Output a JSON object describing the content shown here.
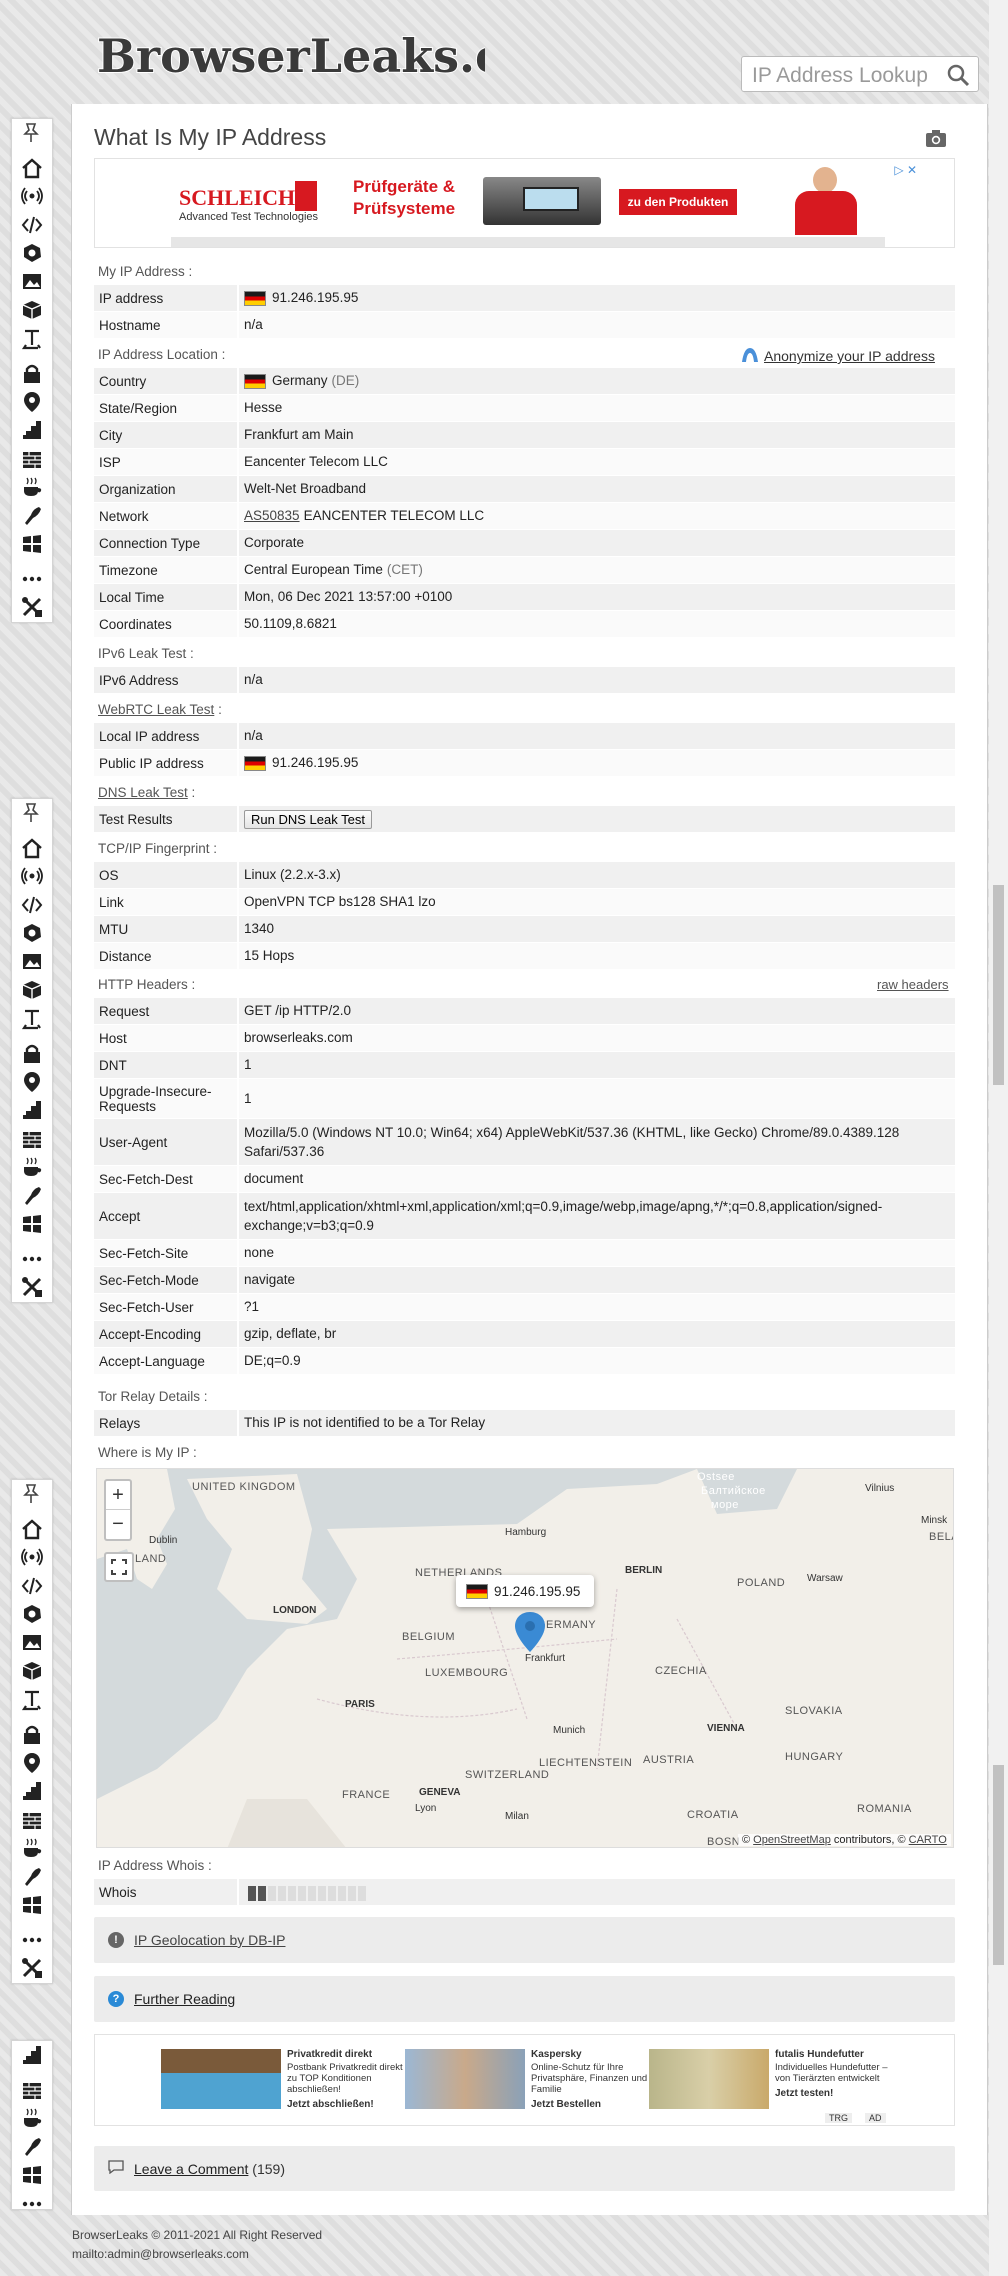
{
  "site": {
    "logo_text": "BrowserLeaks.com"
  },
  "search": {
    "placeholder": "IP Address Lookup"
  },
  "page_title": "What Is My IP Address",
  "ad_top": {
    "brand": "SCHLEICH",
    "tagline": "Advanced Test Technologies",
    "headline1": "Prüfgeräte &",
    "headline2": "Prüfsysteme",
    "cta": "zu den Produkten"
  },
  "sections": {
    "my_ip": "My IP Address :",
    "location": "IP Address Location :",
    "ipv6": "IPv6 Leak Test :",
    "webrtc": "WebRTC Leak Test",
    "dns": "DNS Leak Test",
    "tcpip": "TCP/IP Fingerprint :",
    "http": "HTTP Headers :",
    "tor": "Tor Relay Details :",
    "where": "Where is My IP :",
    "whois": "IP Address Whois :"
  },
  "anonymize_link": "Anonymize your IP address",
  "raw_headers_link": "raw headers",
  "my_ip": {
    "ip_label": "IP address",
    "ip_value": "91.246.195.95",
    "host_label": "Hostname",
    "host_value": "n/a"
  },
  "location": [
    {
      "k": "Country",
      "v": "Germany",
      "extra": "(DE)"
    },
    {
      "k": "State/Region",
      "v": "Hesse"
    },
    {
      "k": "City",
      "v": "Frankfurt am Main"
    },
    {
      "k": "ISP",
      "v": "Eancenter Telecom LLC"
    },
    {
      "k": "Organization",
      "v": "Welt-Net Broadband"
    },
    {
      "k": "Network",
      "link": "AS50835",
      "v": "EANCENTER TELECOM LLC"
    },
    {
      "k": "Connection Type",
      "v": "Corporate"
    },
    {
      "k": "Timezone",
      "v": "Central European Time",
      "extra": "(CET)"
    },
    {
      "k": "Local Time",
      "v": "Mon, 06 Dec 2021 13:57:00 +0100"
    },
    {
      "k": "Coordinates",
      "v": "50.1109,8.6821"
    }
  ],
  "ipv6": {
    "k": "IPv6 Address",
    "v": "n/a"
  },
  "webrtc": {
    "local_k": "Local IP address",
    "local_v": "n/a",
    "public_k": "Public IP address",
    "public_v": "91.246.195.95"
  },
  "dns": {
    "k": "Test Results",
    "button": "Run DNS Leak Test"
  },
  "tcpip": [
    {
      "k": "OS",
      "v": "Linux (2.2.x-3.x)"
    },
    {
      "k": "Link",
      "v": "OpenVPN TCP bs128 SHA1 lzo"
    },
    {
      "k": "MTU",
      "v": "1340"
    },
    {
      "k": "Distance",
      "v": "15 Hops"
    }
  ],
  "http": [
    {
      "k": "Request",
      "v": "GET /ip HTTP/2.0"
    },
    {
      "k": "Host",
      "v": "browserleaks.com"
    },
    {
      "k": "DNT",
      "v": "1"
    },
    {
      "k": "Upgrade-Insecure-Requests",
      "v": "1"
    },
    {
      "k": "User-Agent",
      "v": "Mozilla/5.0 (Windows NT 10.0; Win64; x64) AppleWebKit/537.36 (KHTML, like Gecko) Chrome/89.0.4389.128 Safari/537.36"
    },
    {
      "k": "Sec-Fetch-Dest",
      "v": "document"
    },
    {
      "k": "Accept",
      "v": "text/html,application/xhtml+xml,application/xml;q=0.9,image/webp,image/apng,*/*;q=0.8,application/signed-exchange;v=b3;q=0.9"
    },
    {
      "k": "Sec-Fetch-Site",
      "v": "none"
    },
    {
      "k": "Sec-Fetch-Mode",
      "v": "navigate"
    },
    {
      "k": "Sec-Fetch-User",
      "v": "?1"
    },
    {
      "k": "Accept-Encoding",
      "v": "gzip, deflate, br"
    },
    {
      "k": "Accept-Language",
      "v": "DE;q=0.9"
    }
  ],
  "tor": {
    "k": "Relays",
    "v": "This IP is not identified to be a Tor Relay"
  },
  "map": {
    "popup": "91.246.195.95",
    "zoom_in": "+",
    "zoom_out": "−",
    "attribution_prefix": "©",
    "osm": "OpenStreetMap",
    "contrib": "contributors, ©",
    "carto": "CARTO",
    "countries": [
      "UNITED KINGDOM",
      "NETHERLANDS",
      "BELGIUM",
      "LUXEMBOURG",
      "GERMANY",
      "POLAND",
      "CZECHIA",
      "SLOVAKIA",
      "FRANCE",
      "SWITZERLAND",
      "LIECHTENSTEIN",
      "AUSTRIA",
      "HUNGARY",
      "CROATIA",
      "ROMANIA",
      "BOSN",
      "BELA",
      "LAND"
    ],
    "cities": [
      "Dublin",
      "LONDON",
      "Hamburg",
      "BERLIN",
      "Warsaw",
      "PARIS",
      "Frankfurt",
      "Munich",
      "VIENNA",
      "GENEVA",
      "Lyon",
      "Milan",
      "Vilnius",
      "Minsk"
    ],
    "sea": [
      "Ostsee",
      "Балтийское",
      "море"
    ]
  },
  "whois": {
    "k": "Whois"
  },
  "geo_box": "IP Geolocation by DB-IP",
  "further_box": "Further Reading",
  "ad_bottom": [
    {
      "title": "Privatkredit direkt",
      "body": "Postbank Privatkredit direkt zu TOP Konditionen abschließen!",
      "cta": "Jetzt abschließen!"
    },
    {
      "title": "Kaspersky",
      "body": "Online-Schutz für Ihre Privatsphäre, Finanzen und Familie",
      "cta": "Jetzt Bestellen"
    },
    {
      "title": "futalis Hundefutter",
      "body": "Individuelles Hundefutter – von Tierärzten entwickelt",
      "cta": "Jetzt testen!"
    }
  ],
  "ad_tags": [
    "TRG",
    "AD"
  ],
  "comments": {
    "label": "Leave a Comment",
    "count": "(159)"
  },
  "footer": {
    "copy": "BrowserLeaks © 2011-2021 All Right Reserved",
    "mail": "mailto:admin@browserleaks.com"
  },
  "colors": {
    "accent": "#4a90d9",
    "map_pin": "#3a8ad4",
    "ad_red": "#d71920"
  }
}
